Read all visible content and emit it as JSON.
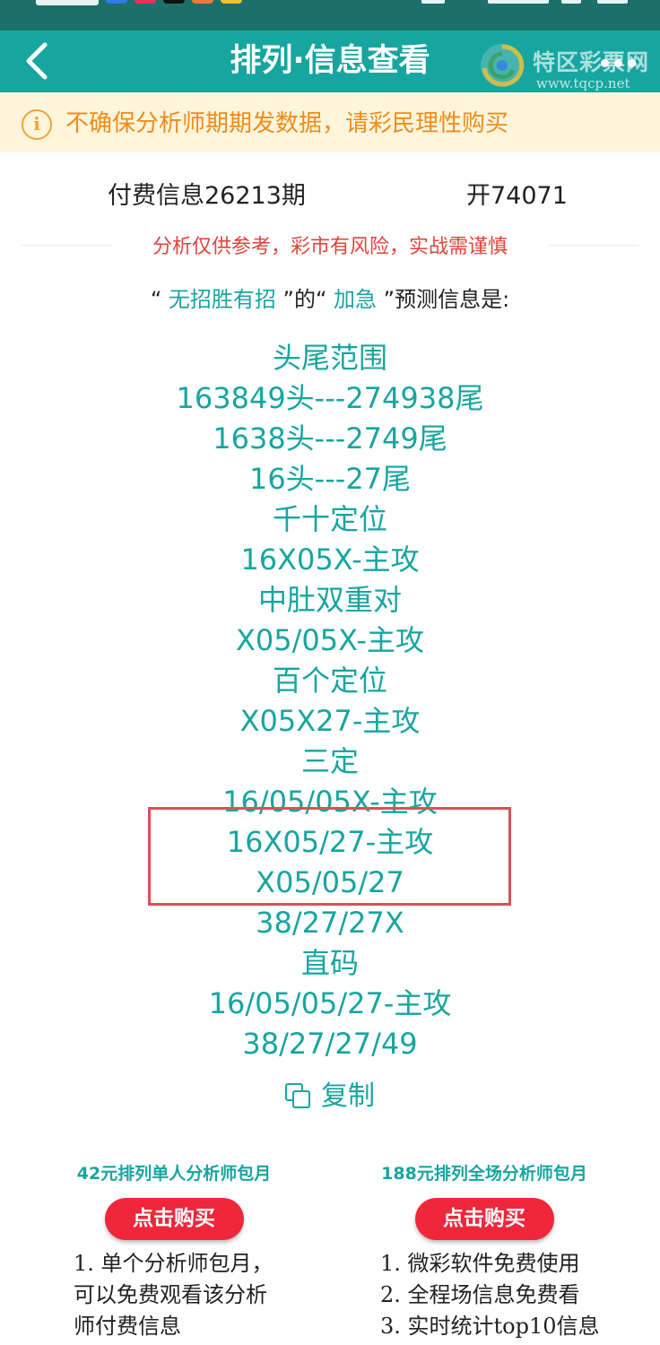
{
  "colors": {
    "statusbar": "#1d6f6b",
    "navbar": "#17a5a0",
    "accent_teal": "#17a5a0",
    "warning_orange": "#f08c1a",
    "warning_bg": "#fdf5dc",
    "risk_red": "#e2433b",
    "buy_button": "#f0273b",
    "highlight_box": "#db4f58"
  },
  "header": {
    "title": "排列·信息查看",
    "back_icon": "chevron-left-icon",
    "more_icon": "more-horizontal-icon"
  },
  "watermark": {
    "name": "特区彩票网",
    "url": "www.tqcp.net"
  },
  "notice": {
    "icon": "info-icon",
    "icon_glyph": "i",
    "text": "不确保分析师期期发数据，请彩民理性购买"
  },
  "issue": {
    "label": "付费信息26213期",
    "open_result": "开74071"
  },
  "risk_notice": "分析仅供参考，彩市有风险，实战需谨慎",
  "headline": {
    "quote_open_1": "“ ",
    "analyst": "无招胜有招",
    "middle": " ”的“ ",
    "tag": "加急",
    "suffix": " ”预测信息是:"
  },
  "predictions": [
    "头尾范围",
    "163849头---274938尾",
    "1638头---2749尾",
    "16头---27尾",
    "千十定位",
    "16X05X-主攻",
    "中肚双重对",
    "X05/05X-主攻",
    "百个定位",
    "X05X27-主攻",
    "三定",
    "16/05/05X-主攻",
    "16X05/27-主攻",
    "X05/05/27",
    "38/27/27X",
    "直码",
    "16/05/05/27-主攻",
    "38/27/27/49"
  ],
  "copy": {
    "icon": "copy-icon",
    "label": "复制"
  },
  "plans": [
    {
      "title": "42元排列单人分析师包月",
      "button": "点击购买",
      "desc": [
        "1. 单个分析师包月，",
        "可以免费观看该分析",
        "师付费信息"
      ]
    },
    {
      "title": "188元排列全场分析师包月",
      "button": "点击购买",
      "desc": [
        "1. 微彩软件免费使用",
        "2. 全程场信息免费看",
        "3. 实时统计top10信息"
      ]
    }
  ]
}
